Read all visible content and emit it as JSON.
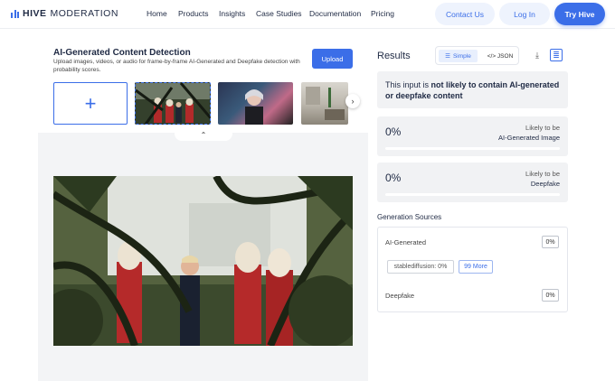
{
  "nav": {
    "logo_bold": "HIVE",
    "logo_light": "MODERATION",
    "menu": [
      "Home",
      "Products",
      "Insights",
      "Case Studies",
      "Documentation",
      "Pricing"
    ],
    "contact_label": "Contact Us",
    "login_label": "Log In",
    "try_label": "Try Hive"
  },
  "detector": {
    "title": "AI-Generated Content Detection",
    "description": "Upload images, videos, or audio for frame-by-frame AI-Generated and Deepfake detection with probability scores.",
    "upload_label": "Upload",
    "add_symbol": "+"
  },
  "results": {
    "title": "Results",
    "toggle_simple": "Simple",
    "toggle_json": "</> JSON",
    "verdict_prefix": "This input is ",
    "verdict_bold": "not likely",
    "verdict_suffix": " to contain AI-generated or deepfake content",
    "scores": [
      {
        "percent_label": "0%",
        "value": 0,
        "line1": "Likely to be",
        "line2": "AI-Generated Image"
      },
      {
        "percent_label": "0%",
        "value": 0,
        "line1": "Likely to be",
        "line2": "Deepfake"
      }
    ]
  },
  "generation": {
    "title": "Generation Sources",
    "ai_label": "AI-Generated",
    "ai_value": "0%",
    "chip_source": "stablediffusion: 0%",
    "chip_more": "99 More",
    "deepfake_label": "Deepfake",
    "deepfake_value": "0%"
  },
  "colors": {
    "accent": "#3b6ee8",
    "card_bg": "#f1f2f4"
  }
}
